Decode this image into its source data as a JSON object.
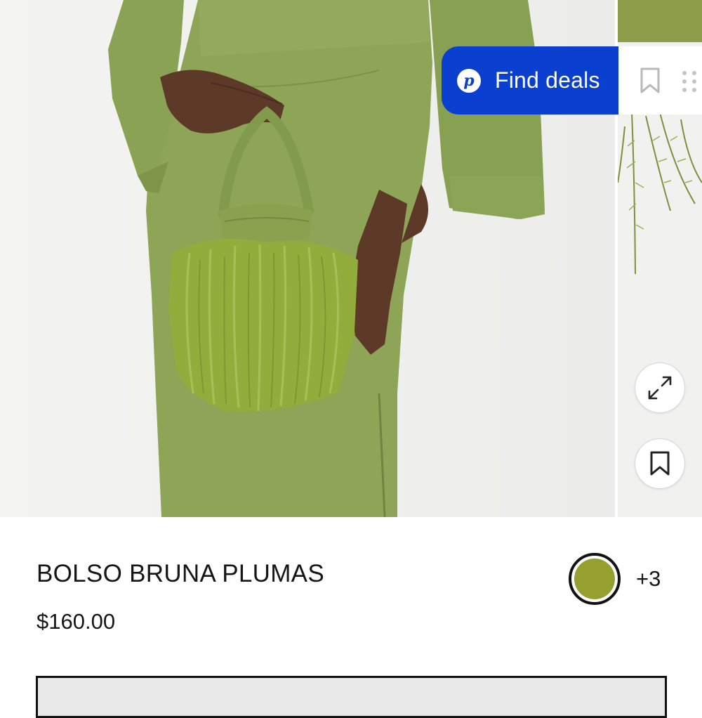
{
  "product": {
    "title": "BOLSO BRUNA PLUMAS",
    "price": "$160.00",
    "selected_color": "#95a030",
    "more_colors": "+3"
  },
  "deals": {
    "logo_letter": "p",
    "label": "Find deals",
    "accent": "#0a3fcf"
  },
  "icons": {
    "deals_bookmark": "bookmark-outline-icon",
    "drag_handle": "drag-grip-icon",
    "expand": "expand-diagonal-icon",
    "save": "bookmark-icon"
  },
  "colors": {
    "dress": "#8ea457",
    "feathers": "#92ad3c"
  }
}
